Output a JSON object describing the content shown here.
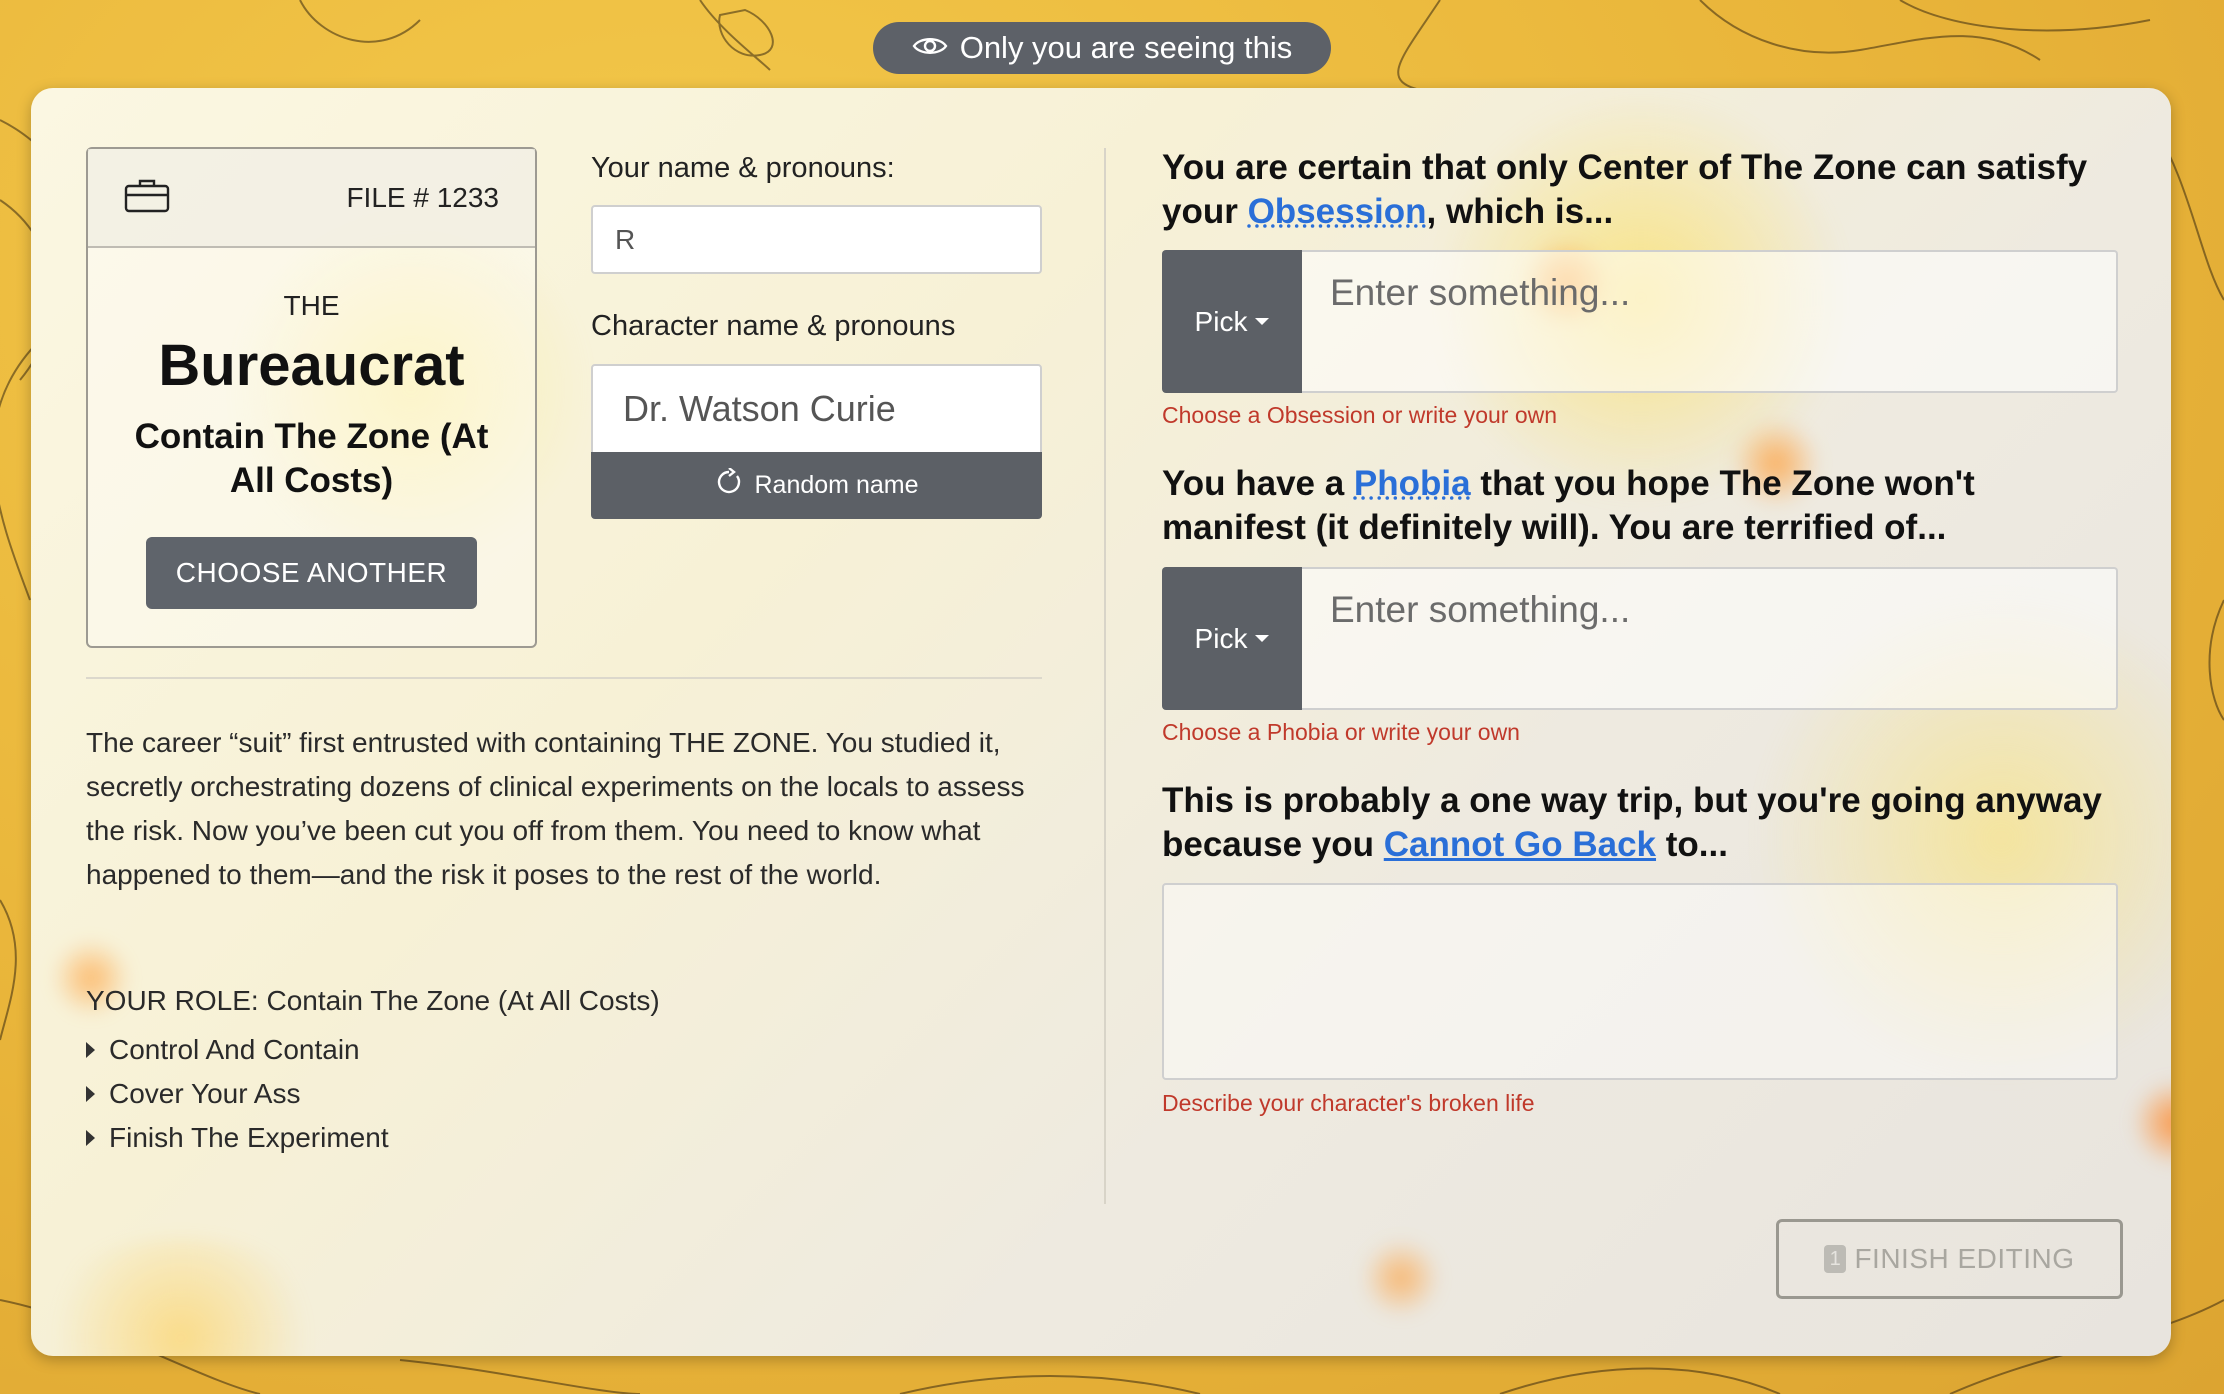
{
  "banner": {
    "text": "Only you are seeing this",
    "icon": "eye-icon"
  },
  "archetype": {
    "file_label": "FILE # 1233",
    "the": "THE",
    "name": "Bureaucrat",
    "role": "Contain The Zone (At All Costs)",
    "choose_button": "CHOOSE ANOTHER",
    "icon": "briefcase-icon"
  },
  "player": {
    "label": "Your name & pronouns:",
    "value": "R"
  },
  "character": {
    "label": "Character name & pronouns",
    "value": "Dr. Watson Curie",
    "random_button": "Random name"
  },
  "description": "The career “suit” first entrusted with containing THE ZONE. You studied it, secretly orchestrating dozens of clinical experiments on the locals to assess the risk. Now you’ve been cut you off from them. You need to know what happened to them—and the risk it poses to the rest of the world.",
  "role_section": {
    "title": "YOUR ROLE: Contain The Zone (At All Costs)",
    "items": [
      "Control And Contain",
      "Cover Your Ass",
      "Finish The Experiment"
    ]
  },
  "questions": {
    "obsession": {
      "prefix": "You are certain that only Center of The Zone can satisfy your ",
      "link": "Obsession",
      "suffix": ", which is...",
      "pick": "Pick",
      "placeholder": "Enter something...",
      "hint": "Choose a Obsession or write your own"
    },
    "phobia": {
      "prefix": "You have a ",
      "link": "Phobia",
      "suffix": " that you hope The Zone won't manifest (it definitely will). You are terrified of...",
      "pick": "Pick",
      "placeholder": "Enter something...",
      "hint": "Choose a Phobia or write your own"
    },
    "cannot_go_back": {
      "prefix": "This is probably a one way trip, but you're going anyway because you ",
      "link": "Cannot Go Back",
      "suffix": " to...",
      "hint": "Describe your character's broken life"
    }
  },
  "finish": {
    "badge": "1",
    "label": "FINISH EDITING"
  }
}
